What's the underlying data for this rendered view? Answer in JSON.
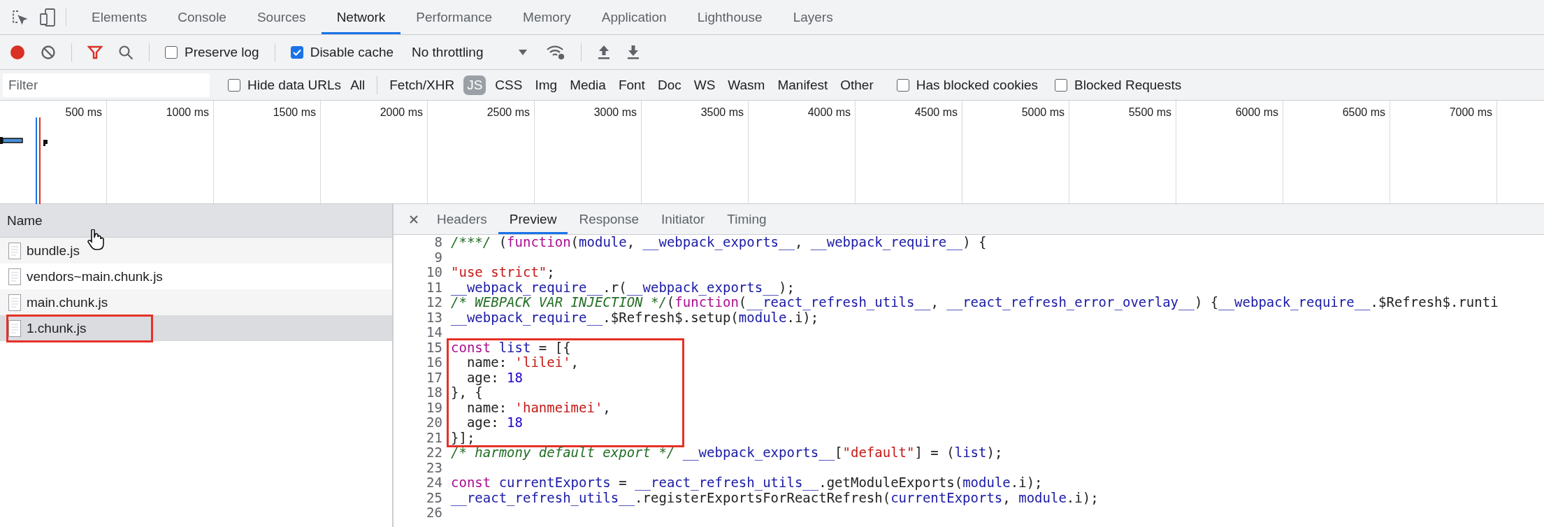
{
  "panel_tabs": [
    {
      "label": "Elements",
      "selected": false
    },
    {
      "label": "Console",
      "selected": false
    },
    {
      "label": "Sources",
      "selected": false
    },
    {
      "label": "Network",
      "selected": true
    },
    {
      "label": "Performance",
      "selected": false
    },
    {
      "label": "Memory",
      "selected": false
    },
    {
      "label": "Application",
      "selected": false
    },
    {
      "label": "Lighthouse",
      "selected": false
    },
    {
      "label": "Layers",
      "selected": false
    }
  ],
  "toolbar": {
    "preserve_log": {
      "label": "Preserve log",
      "checked": false
    },
    "disable_cache": {
      "label": "Disable cache",
      "checked": true
    },
    "throttling": {
      "value": "No throttling"
    }
  },
  "filter_bar": {
    "placeholder": "Filter",
    "hide_data_urls": {
      "label": "Hide data URLs",
      "checked": false
    },
    "types": [
      {
        "label": "All",
        "selected": false
      },
      {
        "label": "Fetch/XHR",
        "selected": false
      },
      {
        "label": "JS",
        "selected": true
      },
      {
        "label": "CSS",
        "selected": false
      },
      {
        "label": "Img",
        "selected": false
      },
      {
        "label": "Media",
        "selected": false
      },
      {
        "label": "Font",
        "selected": false
      },
      {
        "label": "Doc",
        "selected": false
      },
      {
        "label": "WS",
        "selected": false
      },
      {
        "label": "Wasm",
        "selected": false
      },
      {
        "label": "Manifest",
        "selected": false
      },
      {
        "label": "Other",
        "selected": false
      }
    ],
    "has_blocked_cookies": {
      "label": "Has blocked cookies",
      "checked": false
    },
    "blocked_requests": {
      "label": "Blocked Requests",
      "checked": false
    }
  },
  "overview": {
    "ticks": [
      "500 ms",
      "1000 ms",
      "1500 ms",
      "2000 ms",
      "2500 ms",
      "3000 ms",
      "3500 ms",
      "4000 ms",
      "4500 ms",
      "5000 ms",
      "5500 ms",
      "6000 ms",
      "6500 ms",
      "7000 ms"
    ]
  },
  "requests": {
    "column": "Name",
    "rows": [
      {
        "name": "bundle.js",
        "selected": false,
        "annotated": false
      },
      {
        "name": "vendors~main.chunk.js",
        "selected": false,
        "annotated": false
      },
      {
        "name": "main.chunk.js",
        "selected": false,
        "annotated": false
      },
      {
        "name": "1.chunk.js",
        "selected": true,
        "annotated": true
      }
    ]
  },
  "details": {
    "tabs": [
      {
        "label": "Headers",
        "selected": false
      },
      {
        "label": "Preview",
        "selected": true
      },
      {
        "label": "Response",
        "selected": false
      },
      {
        "label": "Initiator",
        "selected": false
      },
      {
        "label": "Timing",
        "selected": false
      }
    ],
    "code": {
      "blocks": [
        {
          "annotated": false,
          "lines": [
            {
              "number": "8",
              "tokens": [
                {
                  "kind": "comment",
                  "text": "/***/ "
                },
                {
                  "kind": "plain",
                  "text": "("
                },
                {
                  "kind": "keyword",
                  "text": "function"
                },
                {
                  "kind": "plain",
                  "text": "("
                },
                {
                  "kind": "ident",
                  "text": "module"
                },
                {
                  "kind": "plain",
                  "text": ", "
                },
                {
                  "kind": "ident",
                  "text": "__webpack_exports__"
                },
                {
                  "kind": "plain",
                  "text": ", "
                },
                {
                  "kind": "ident",
                  "text": "__webpack_require__"
                },
                {
                  "kind": "plain",
                  "text": ") {"
                }
              ]
            },
            {
              "number": "9"
            },
            {
              "number": "10",
              "tokens": [
                {
                  "kind": "string",
                  "text": "\"use strict\""
                },
                {
                  "kind": "plain",
                  "text": ";"
                }
              ]
            },
            {
              "number": "11",
              "tokens": [
                {
                  "kind": "ident",
                  "text": "__webpack_require__"
                },
                {
                  "kind": "plain",
                  "text": ".r("
                },
                {
                  "kind": "ident",
                  "text": "__webpack_exports__"
                },
                {
                  "kind": "plain",
                  "text": ");"
                }
              ]
            },
            {
              "number": "12",
              "tokens": [
                {
                  "kind": "comment",
                  "text": "/* WEBPACK VAR INJECTION */"
                },
                {
                  "kind": "plain",
                  "text": "("
                },
                {
                  "kind": "keyword",
                  "text": "function"
                },
                {
                  "kind": "plain",
                  "text": "("
                },
                {
                  "kind": "ident",
                  "text": "__react_refresh_utils__"
                },
                {
                  "kind": "plain",
                  "text": ", "
                },
                {
                  "kind": "ident",
                  "text": "__react_refresh_error_overlay__"
                },
                {
                  "kind": "plain",
                  "text": ") {"
                },
                {
                  "kind": "ident",
                  "text": "__webpack_require__"
                },
                {
                  "kind": "plain",
                  "text": ".$Refresh$.runti"
                }
              ]
            },
            {
              "number": "13",
              "tokens": [
                {
                  "kind": "ident",
                  "text": "__webpack_require__"
                },
                {
                  "kind": "plain",
                  "text": ".$Refresh$.setup("
                },
                {
                  "kind": "ident",
                  "text": "module"
                },
                {
                  "kind": "plain",
                  "text": ".i);"
                }
              ]
            },
            {
              "number": "14"
            }
          ]
        },
        {
          "annotated": true,
          "lines": [
            {
              "number": "15",
              "tokens": [
                {
                  "kind": "keyword",
                  "text": "const"
                },
                {
                  "kind": "ident",
                  "text": " list"
                },
                {
                  "kind": "plain",
                  "text": " = [{"
                }
              ]
            },
            {
              "number": "16",
              "tokens": [
                {
                  "kind": "plain",
                  "text": "  name: "
                },
                {
                  "kind": "string",
                  "text": "'lilei'"
                },
                {
                  "kind": "plain",
                  "text": ","
                }
              ]
            },
            {
              "number": "17",
              "tokens": [
                {
                  "kind": "plain",
                  "text": "  age: "
                },
                {
                  "kind": "number",
                  "text": "18"
                }
              ]
            },
            {
              "number": "18",
              "tokens": [
                {
                  "kind": "plain",
                  "text": "}, {"
                }
              ]
            },
            {
              "number": "19",
              "tokens": [
                {
                  "kind": "plain",
                  "text": "  name: "
                },
                {
                  "kind": "string",
                  "text": "'hanmeimei'"
                },
                {
                  "kind": "plain",
                  "text": ","
                }
              ]
            },
            {
              "number": "20",
              "tokens": [
                {
                  "kind": "plain",
                  "text": "  age: "
                },
                {
                  "kind": "number",
                  "text": "18"
                }
              ]
            },
            {
              "number": "21",
              "tokens": [
                {
                  "kind": "plain",
                  "text": "}];"
                }
              ]
            }
          ]
        },
        {
          "annotated": false,
          "lines": [
            {
              "number": "22",
              "tokens": [
                {
                  "kind": "comment",
                  "text": "/* harmony default export */"
                },
                {
                  "kind": "ident",
                  "text": " __webpack_exports__"
                },
                {
                  "kind": "plain",
                  "text": "["
                },
                {
                  "kind": "string",
                  "text": "\"default\""
                },
                {
                  "kind": "plain",
                  "text": "] = ("
                },
                {
                  "kind": "ident",
                  "text": "list"
                },
                {
                  "kind": "plain",
                  "text": ");"
                }
              ]
            },
            {
              "number": "23"
            },
            {
              "number": "24",
              "tokens": [
                {
                  "kind": "keyword",
                  "text": "const"
                },
                {
                  "kind": "ident",
                  "text": " currentExports"
                },
                {
                  "kind": "plain",
                  "text": " = "
                },
                {
                  "kind": "ident",
                  "text": "__react_refresh_utils__"
                },
                {
                  "kind": "plain",
                  "text": ".getModuleExports("
                },
                {
                  "kind": "ident",
                  "text": "module"
                },
                {
                  "kind": "plain",
                  "text": ".i);"
                }
              ]
            },
            {
              "number": "25",
              "tokens": [
                {
                  "kind": "ident",
                  "text": "__react_refresh_utils__"
                },
                {
                  "kind": "plain",
                  "text": ".registerExportsForReactRefresh("
                },
                {
                  "kind": "ident",
                  "text": "currentExports"
                },
                {
                  "kind": "plain",
                  "text": ", "
                },
                {
                  "kind": "ident",
                  "text": "module"
                },
                {
                  "kind": "plain",
                  "text": ".i);"
                }
              ]
            },
            {
              "number": "26"
            }
          ]
        }
      ]
    }
  }
}
